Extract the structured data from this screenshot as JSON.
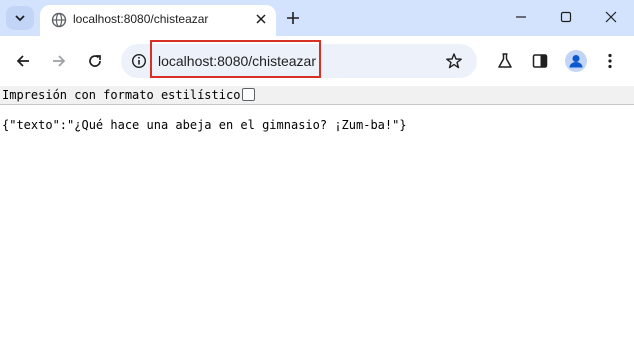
{
  "browser": {
    "tab": {
      "title": "localhost:8080/chisteazar",
      "favicon": "globe-icon"
    },
    "address_bar": {
      "url": "localhost:8080/chisteazar",
      "highlight_color": "#d93025"
    },
    "toolbar_icons": [
      "back-icon",
      "forward-icon",
      "reload-icon",
      "site-info-icon",
      "bookmark-star-icon",
      "labs-flask-icon",
      "side-panel-icon",
      "profile-icon",
      "menu-icon"
    ],
    "window_controls": [
      "minimize-icon",
      "maximize-icon",
      "close-icon"
    ]
  },
  "page": {
    "pretty_print_label": "Impresión con formato estilístico",
    "pretty_print_checked": false,
    "json_text": "{\"texto\":\"¿Qué hace una abeja en el gimnasio? ¡Zum-ba!\"}"
  },
  "colors": {
    "tabstrip": "#d3e3fd",
    "omnibox": "#edf2fa"
  }
}
